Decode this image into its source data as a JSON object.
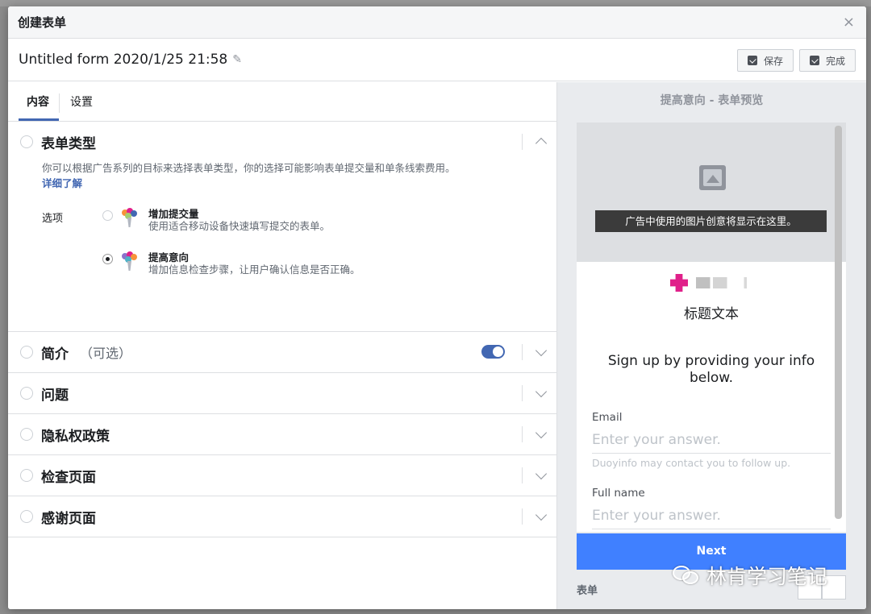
{
  "dialog": {
    "title": "创建表单",
    "close_glyph": "×"
  },
  "form": {
    "name": "Untitled form 2020/1/25 21:58",
    "save_label": "保存",
    "done_label": "完成"
  },
  "tabs": [
    {
      "label": "内容",
      "active": true
    },
    {
      "label": "设置",
      "active": false
    }
  ],
  "form_type": {
    "title": "表单类型",
    "description": "你可以根据广告系列的目标来选择表单类型，你的选择可能影响表单提交量和单条线索费用。",
    "learn_more": "详细了解",
    "options_label": "选项",
    "options": [
      {
        "title": "增加提交量",
        "desc": "使用适合移动设备快速填写提交的表单。",
        "selected": false
      },
      {
        "title": "提高意向",
        "desc": "增加信息检查步骤，让用户确认信息是否正确。",
        "selected": true
      }
    ]
  },
  "sections": [
    {
      "title": "简介",
      "optional": "（可选）",
      "toggle_on": true
    },
    {
      "title": "问题"
    },
    {
      "title": "隐私权政策"
    },
    {
      "title": "检查页面"
    },
    {
      "title": "感谢页面"
    }
  ],
  "preview": {
    "title": "提高意向 - 表单预览",
    "image_caption": "广告中使用的图片创意将显示在这里。",
    "headline": "标题文本",
    "signup_text": "Sign up by providing your info below.",
    "email_label": "Email",
    "email_placeholder": "Enter your answer.",
    "email_hint": "Duoyinfo may contact you to follow up.",
    "fullname_label": "Full name",
    "fullname_placeholder": "Enter your answer.",
    "next_label": "Next",
    "footer_label": "表单"
  },
  "watermark": {
    "text": "林肯学习笔记"
  },
  "colors": {
    "accent": "#4267b2",
    "next_button": "#4080ff",
    "brand_logo": "#e0208a"
  }
}
